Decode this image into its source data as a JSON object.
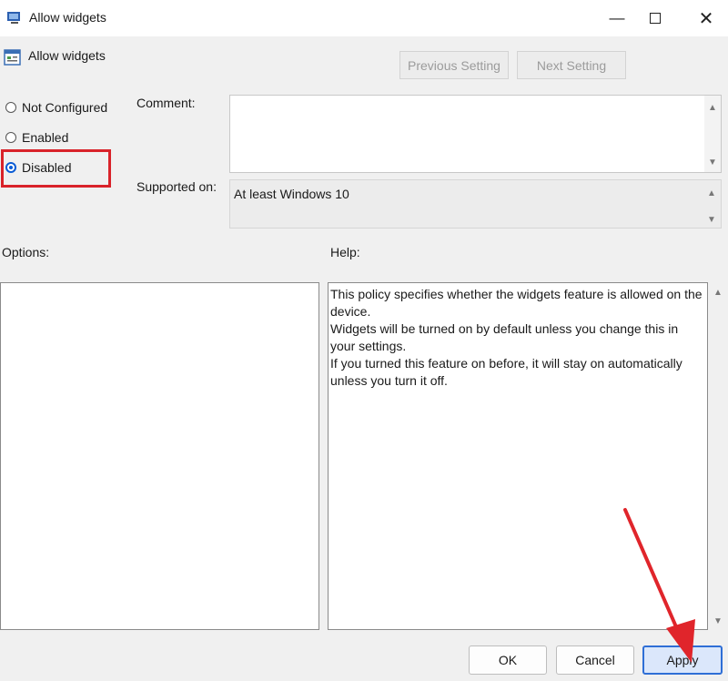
{
  "window": {
    "title": "Allow widgets"
  },
  "header": {
    "policy_name": "Allow widgets",
    "previous_setting": "Previous Setting",
    "next_setting": "Next Setting"
  },
  "state": {
    "options": [
      {
        "label": "Not Configured",
        "selected": false
      },
      {
        "label": "Enabled",
        "selected": false
      },
      {
        "label": "Disabled",
        "selected": true
      }
    ]
  },
  "comment": {
    "label": "Comment:",
    "value": ""
  },
  "supported": {
    "label": "Supported on:",
    "value": "At least Windows 10"
  },
  "options_panel": {
    "label": "Options:"
  },
  "help": {
    "label": "Help:",
    "lines": [
      "This policy specifies whether the widgets feature is allowed on the",
      "device.",
      "Widgets will be turned on by default unless you change this in",
      "your settings.",
      "If you turned this feature on before, it will stay on automatically",
      "unless you turn it off."
    ]
  },
  "buttons": {
    "ok": "OK",
    "cancel": "Cancel",
    "apply": "Apply"
  },
  "colors": {
    "highlight": "#d9232a",
    "radio_selected": "#0b5cd5",
    "apply_border": "#2f6fd6"
  }
}
